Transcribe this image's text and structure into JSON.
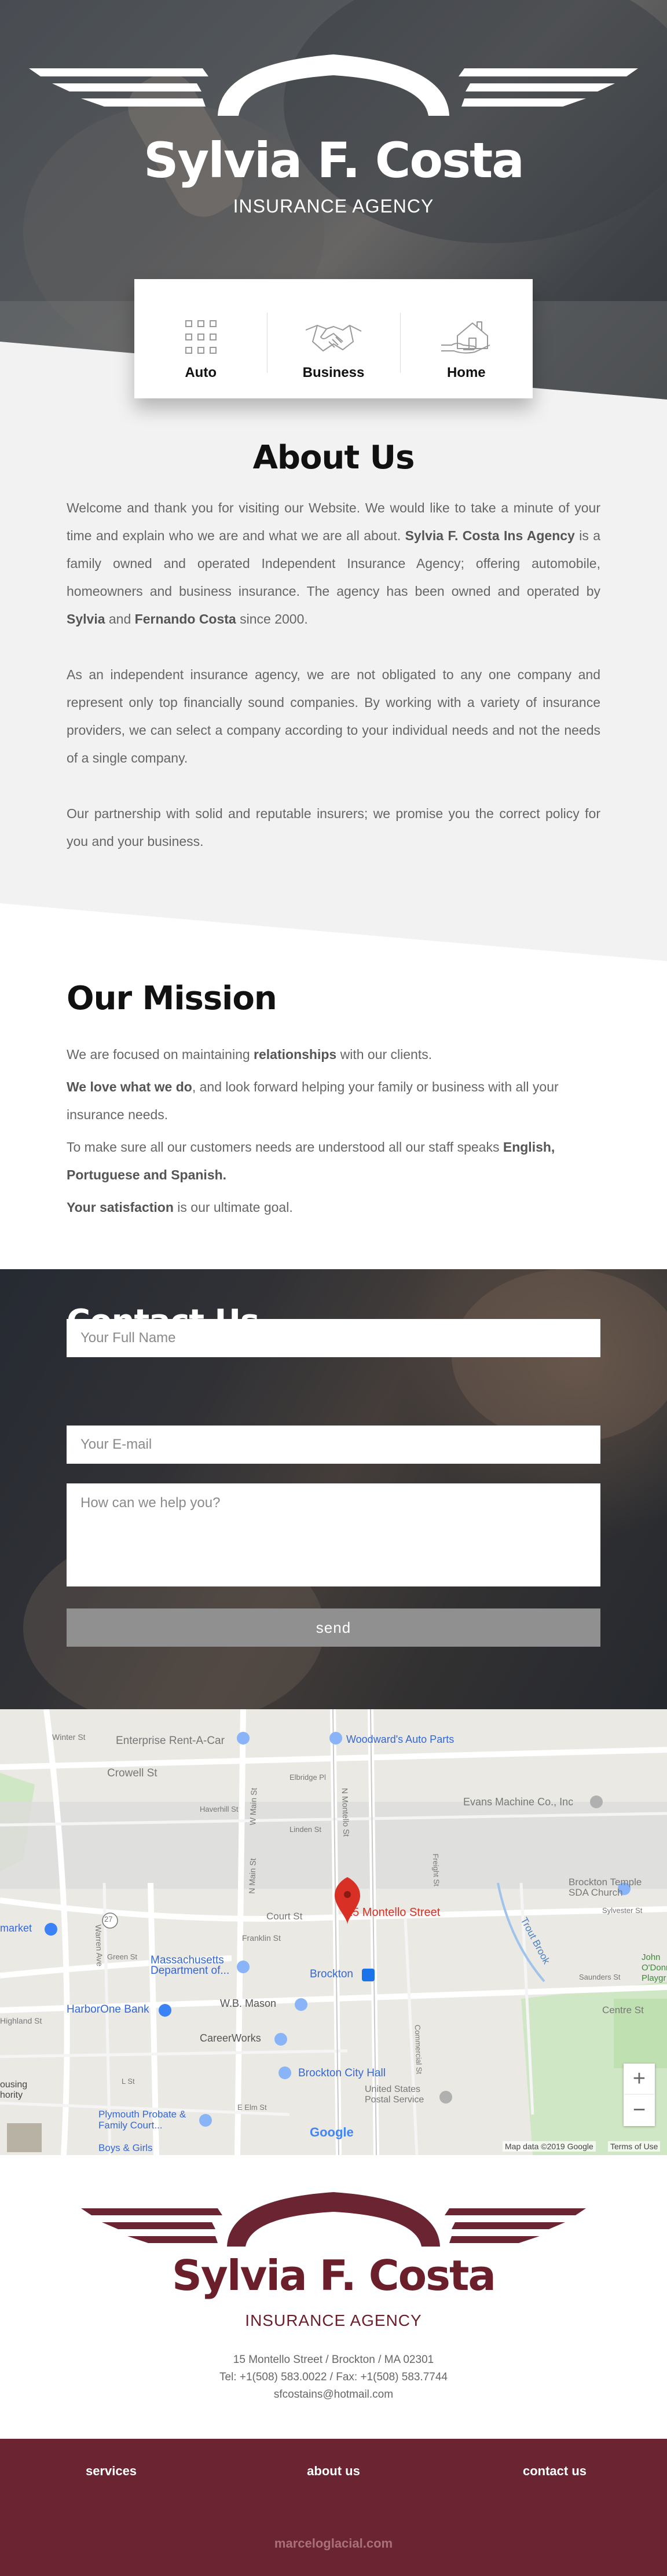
{
  "brand": {
    "name": "Sylvia F. Costa",
    "tagline": "INSURANCE AGENCY"
  },
  "services": [
    {
      "label": "Auto",
      "icon": "auto-icon"
    },
    {
      "label": "Business",
      "icon": "handshake-icon"
    },
    {
      "label": "Home",
      "icon": "home-icon"
    }
  ],
  "about": {
    "title": "About Us",
    "p1_a": "Welcome and thank you for visiting our Website. We would like to take a minute of your time and explain who we are and what we are all about. ",
    "p1_b": "Sylvia F. Costa Ins Agency",
    "p1_c": " is a family owned and operated Independent Insurance Agency; offering automobile, homeowners and business insurance. The agency has been owned and operated by ",
    "p1_d": "Sylvia",
    "p1_e": " and ",
    "p1_f": "Fernando Costa",
    "p1_g": " since 2000.",
    "p2": "As an independent insurance agency, we are not obligated to any one company and represent only top financially sound companies. By working with a variety of insurance providers, we can select a company according to your individual needs and not the needs of a single company.",
    "p3": "Our partnership with solid and reputable insurers; we promise you the correct policy for you and your business."
  },
  "mission": {
    "title": "Our Mission",
    "l1_a": "We are focused on maintaining ",
    "l1_b": "relationships",
    "l1_c": " with our clients.",
    "l2_a": "We love what we do",
    "l2_b": ", and look forward helping your family or business with all your insurance needs.",
    "l3_a": "To make sure all our customers needs are understood all our staff speaks ",
    "l3_b": "English, Portuguese and Spanish.",
    "l4_a": "Your satisfaction",
    "l4_b": " is our ultimate goal."
  },
  "contact": {
    "title": "Contact Us",
    "name_placeholder": "Your Full Name",
    "email_placeholder": "Your E-mail",
    "message_placeholder": "How can we help you?",
    "send_label": "send"
  },
  "map": {
    "pin_label": "15 Montello Street",
    "labels": {
      "winter": "Winter St",
      "enterprise": "Enterprise Rent-A-Car",
      "woodwards": "Woodward's Auto Parts",
      "crowell": "Crowell St",
      "elbridge": "Elbridge Pl",
      "evans": "Evans Machine Co., Inc",
      "haverhill": "Haverhill St",
      "linden": "Linden St",
      "church": "Brockton Temple SDA Church",
      "sylvester": "Sylvester St",
      "market": "market",
      "court": "Court St",
      "franklin": "Franklin St",
      "mass": "Massachusetts Department of...",
      "brockton": "Brockton",
      "trout": "Trout Brook",
      "saunders": "Saunders St",
      "john": "John O'Donr Playgr",
      "harborone": "HarborOne Bank",
      "wbmason": "W.B. Mason",
      "centre": "Centre St",
      "careerworks": "CareerWorks",
      "cityhall": "Brockton City Hall",
      "postal": "United States Postal Service",
      "housing": "ousing hority",
      "plymouth": "Plymouth Probate & Family Court...",
      "boys": "Boys & Girls",
      "elm": "E Elm St",
      "highland": "Highland St",
      "google": "Google",
      "attr": "Map data ©2019 Google",
      "terms": "Terms of Use",
      "plus": "+",
      "minus": "−",
      "nmain": "N Main St",
      "wmain": "W Main St",
      "montello": "N Montello St",
      "ward": "Warren Ave",
      "freight": "Freight St",
      "commercial": "Commercial St",
      "green": "Green St",
      "elst": "L St",
      "route": "27"
    }
  },
  "footer": {
    "address": "15 Montello Street / Brockton / MA 02301",
    "phone": "Tel: +1(508) 583.0022 / Fax: +1(508) 583.7744",
    "email": "sfcostains@hotmail.com",
    "nav": [
      "services",
      "about us",
      "contact us"
    ],
    "credit": "marceloglacial.com"
  },
  "colors": {
    "brand_maroon": "#6b2431",
    "accent_red": "#d93025",
    "button_gray": "#909090"
  }
}
